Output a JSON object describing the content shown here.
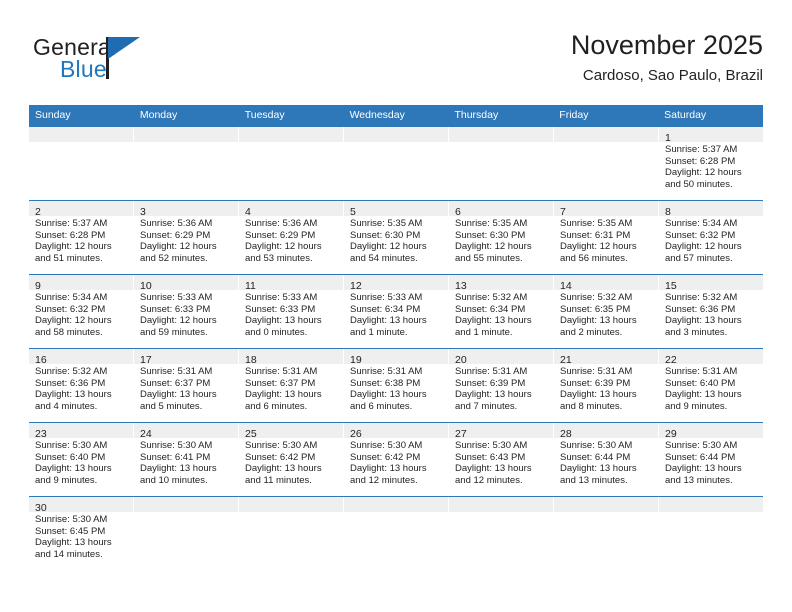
{
  "brand": {
    "name_top": "General",
    "name_bottom": "Blue",
    "triangle_icon": "blue-triangle-logo-mark",
    "accent_color": "#2077bd"
  },
  "header": {
    "month_title": "November 2025",
    "location": "Cardoso, Sao Paulo, Brazil"
  },
  "colors": {
    "header_blue": "#2e77b8",
    "daynum_strip": "#efefef",
    "text": "#231f20"
  },
  "weekdays": [
    "Sunday",
    "Monday",
    "Tuesday",
    "Wednesday",
    "Thursday",
    "Friday",
    "Saturday"
  ],
  "weeks": [
    [
      {
        "day": ""
      },
      {
        "day": ""
      },
      {
        "day": ""
      },
      {
        "day": ""
      },
      {
        "day": ""
      },
      {
        "day": ""
      },
      {
        "day": "1",
        "sunrise": "Sunrise: 5:37 AM",
        "sunset": "Sunset: 6:28 PM",
        "daylight1": "Daylight: 12 hours",
        "daylight2": "and 50 minutes."
      }
    ],
    [
      {
        "day": "2",
        "sunrise": "Sunrise: 5:37 AM",
        "sunset": "Sunset: 6:28 PM",
        "daylight1": "Daylight: 12 hours",
        "daylight2": "and 51 minutes."
      },
      {
        "day": "3",
        "sunrise": "Sunrise: 5:36 AM",
        "sunset": "Sunset: 6:29 PM",
        "daylight1": "Daylight: 12 hours",
        "daylight2": "and 52 minutes."
      },
      {
        "day": "4",
        "sunrise": "Sunrise: 5:36 AM",
        "sunset": "Sunset: 6:29 PM",
        "daylight1": "Daylight: 12 hours",
        "daylight2": "and 53 minutes."
      },
      {
        "day": "5",
        "sunrise": "Sunrise: 5:35 AM",
        "sunset": "Sunset: 6:30 PM",
        "daylight1": "Daylight: 12 hours",
        "daylight2": "and 54 minutes."
      },
      {
        "day": "6",
        "sunrise": "Sunrise: 5:35 AM",
        "sunset": "Sunset: 6:30 PM",
        "daylight1": "Daylight: 12 hours",
        "daylight2": "and 55 minutes."
      },
      {
        "day": "7",
        "sunrise": "Sunrise: 5:35 AM",
        "sunset": "Sunset: 6:31 PM",
        "daylight1": "Daylight: 12 hours",
        "daylight2": "and 56 minutes."
      },
      {
        "day": "8",
        "sunrise": "Sunrise: 5:34 AM",
        "sunset": "Sunset: 6:32 PM",
        "daylight1": "Daylight: 12 hours",
        "daylight2": "and 57 minutes."
      }
    ],
    [
      {
        "day": "9",
        "sunrise": "Sunrise: 5:34 AM",
        "sunset": "Sunset: 6:32 PM",
        "daylight1": "Daylight: 12 hours",
        "daylight2": "and 58 minutes."
      },
      {
        "day": "10",
        "sunrise": "Sunrise: 5:33 AM",
        "sunset": "Sunset: 6:33 PM",
        "daylight1": "Daylight: 12 hours",
        "daylight2": "and 59 minutes."
      },
      {
        "day": "11",
        "sunrise": "Sunrise: 5:33 AM",
        "sunset": "Sunset: 6:33 PM",
        "daylight1": "Daylight: 13 hours",
        "daylight2": "and 0 minutes."
      },
      {
        "day": "12",
        "sunrise": "Sunrise: 5:33 AM",
        "sunset": "Sunset: 6:34 PM",
        "daylight1": "Daylight: 13 hours",
        "daylight2": "and 1 minute."
      },
      {
        "day": "13",
        "sunrise": "Sunrise: 5:32 AM",
        "sunset": "Sunset: 6:34 PM",
        "daylight1": "Daylight: 13 hours",
        "daylight2": "and 1 minute."
      },
      {
        "day": "14",
        "sunrise": "Sunrise: 5:32 AM",
        "sunset": "Sunset: 6:35 PM",
        "daylight1": "Daylight: 13 hours",
        "daylight2": "and 2 minutes."
      },
      {
        "day": "15",
        "sunrise": "Sunrise: 5:32 AM",
        "sunset": "Sunset: 6:36 PM",
        "daylight1": "Daylight: 13 hours",
        "daylight2": "and 3 minutes."
      }
    ],
    [
      {
        "day": "16",
        "sunrise": "Sunrise: 5:32 AM",
        "sunset": "Sunset: 6:36 PM",
        "daylight1": "Daylight: 13 hours",
        "daylight2": "and 4 minutes."
      },
      {
        "day": "17",
        "sunrise": "Sunrise: 5:31 AM",
        "sunset": "Sunset: 6:37 PM",
        "daylight1": "Daylight: 13 hours",
        "daylight2": "and 5 minutes."
      },
      {
        "day": "18",
        "sunrise": "Sunrise: 5:31 AM",
        "sunset": "Sunset: 6:37 PM",
        "daylight1": "Daylight: 13 hours",
        "daylight2": "and 6 minutes."
      },
      {
        "day": "19",
        "sunrise": "Sunrise: 5:31 AM",
        "sunset": "Sunset: 6:38 PM",
        "daylight1": "Daylight: 13 hours",
        "daylight2": "and 6 minutes."
      },
      {
        "day": "20",
        "sunrise": "Sunrise: 5:31 AM",
        "sunset": "Sunset: 6:39 PM",
        "daylight1": "Daylight: 13 hours",
        "daylight2": "and 7 minutes."
      },
      {
        "day": "21",
        "sunrise": "Sunrise: 5:31 AM",
        "sunset": "Sunset: 6:39 PM",
        "daylight1": "Daylight: 13 hours",
        "daylight2": "and 8 minutes."
      },
      {
        "day": "22",
        "sunrise": "Sunrise: 5:31 AM",
        "sunset": "Sunset: 6:40 PM",
        "daylight1": "Daylight: 13 hours",
        "daylight2": "and 9 minutes."
      }
    ],
    [
      {
        "day": "23",
        "sunrise": "Sunrise: 5:30 AM",
        "sunset": "Sunset: 6:40 PM",
        "daylight1": "Daylight: 13 hours",
        "daylight2": "and 9 minutes."
      },
      {
        "day": "24",
        "sunrise": "Sunrise: 5:30 AM",
        "sunset": "Sunset: 6:41 PM",
        "daylight1": "Daylight: 13 hours",
        "daylight2": "and 10 minutes."
      },
      {
        "day": "25",
        "sunrise": "Sunrise: 5:30 AM",
        "sunset": "Sunset: 6:42 PM",
        "daylight1": "Daylight: 13 hours",
        "daylight2": "and 11 minutes."
      },
      {
        "day": "26",
        "sunrise": "Sunrise: 5:30 AM",
        "sunset": "Sunset: 6:42 PM",
        "daylight1": "Daylight: 13 hours",
        "daylight2": "and 12 minutes."
      },
      {
        "day": "27",
        "sunrise": "Sunrise: 5:30 AM",
        "sunset": "Sunset: 6:43 PM",
        "daylight1": "Daylight: 13 hours",
        "daylight2": "and 12 minutes."
      },
      {
        "day": "28",
        "sunrise": "Sunrise: 5:30 AM",
        "sunset": "Sunset: 6:44 PM",
        "daylight1": "Daylight: 13 hours",
        "daylight2": "and 13 minutes."
      },
      {
        "day": "29",
        "sunrise": "Sunrise: 5:30 AM",
        "sunset": "Sunset: 6:44 PM",
        "daylight1": "Daylight: 13 hours",
        "daylight2": "and 13 minutes."
      }
    ],
    [
      {
        "day": "30",
        "sunrise": "Sunrise: 5:30 AM",
        "sunset": "Sunset: 6:45 PM",
        "daylight1": "Daylight: 13 hours",
        "daylight2": "and 14 minutes."
      },
      {
        "day": ""
      },
      {
        "day": ""
      },
      {
        "day": ""
      },
      {
        "day": ""
      },
      {
        "day": ""
      },
      {
        "day": ""
      }
    ]
  ]
}
